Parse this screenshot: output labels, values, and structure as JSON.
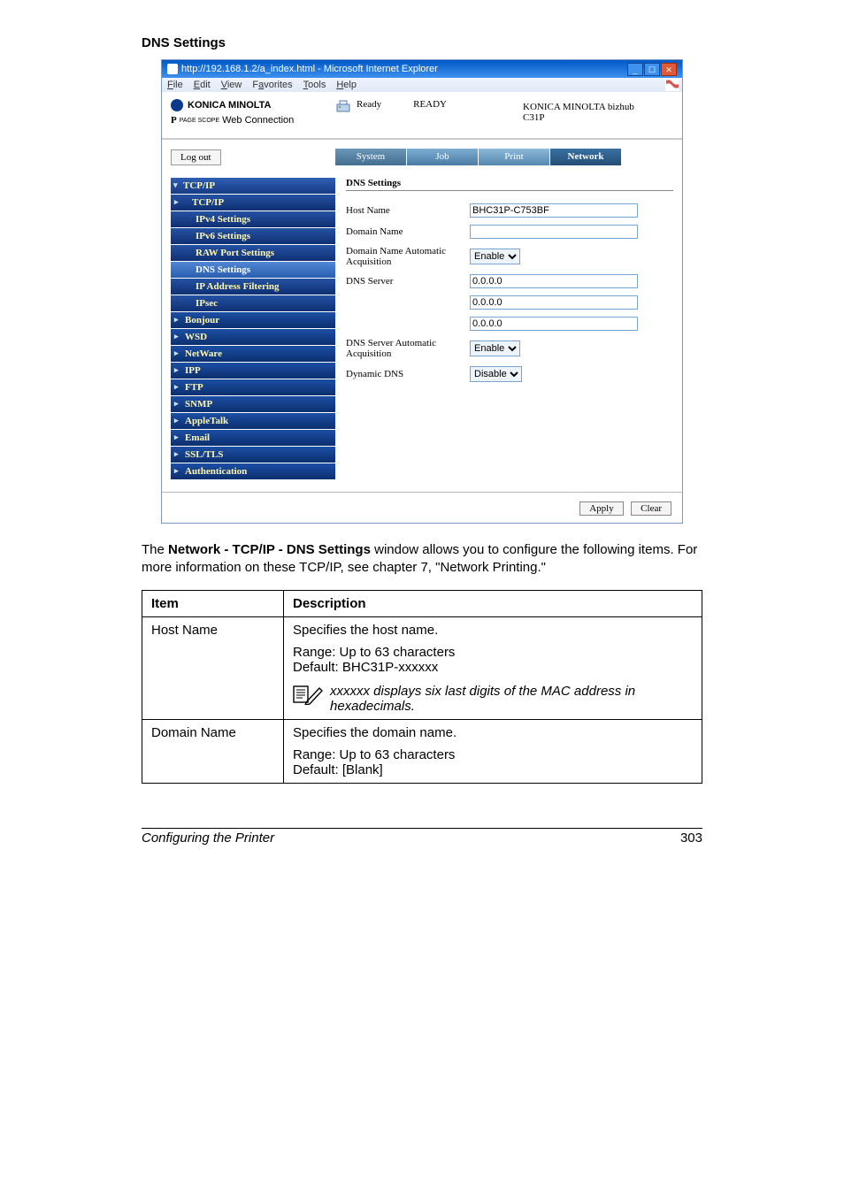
{
  "section_title": "DNS Settings",
  "browser": {
    "title": "http://192.168.1.2/a_index.html - Microsoft Internet Explorer",
    "menu": {
      "file": "File",
      "edit": "Edit",
      "view": "View",
      "favorites": "Favorites",
      "tools": "Tools",
      "help": "Help"
    }
  },
  "header": {
    "brand": "KONICA MINOLTA",
    "pagescope": "PAGE SCOPE",
    "webconn": "Web Connection",
    "ready_label": "Ready",
    "ready_status": "READY",
    "model_line1": "KONICA MINOLTA bizhub",
    "model_line2": "C31P"
  },
  "logout": "Log out",
  "tabs": {
    "system": "System",
    "job": "Job",
    "print": "Print",
    "network": "Network"
  },
  "sidebar": {
    "tcpip": "TCP/IP",
    "tcpip2": "TCP/IP",
    "ipv4": "IPv4 Settings",
    "ipv6": "IPv6 Settings",
    "raw": "RAW Port Settings",
    "dns": "DNS Settings",
    "ipfilter": "IP Address Filtering",
    "ipsec": "IPsec",
    "bonjour": "Bonjour",
    "wsd": "WSD",
    "netware": "NetWare",
    "ipp": "IPP",
    "ftp": "FTP",
    "snmp": "SNMP",
    "appletalk": "AppleTalk",
    "email": "Email",
    "ssltls": "SSL/TLS",
    "auth": "Authentication"
  },
  "panel": {
    "title": "DNS Settings",
    "host_name_label": "Host Name",
    "host_name_value": "BHC31P-C753BF",
    "domain_name_label": "Domain Name",
    "domain_name_value": "",
    "domain_auto_label": "Domain Name Automatic Acquisition",
    "domain_auto_value": "Enable",
    "dns_server_label": "DNS Server",
    "dns_server1": "0.0.0.0",
    "dns_server2": "0.0.0.0",
    "dns_server3": "0.0.0.0",
    "dns_auto_label": "DNS Server Automatic Acquisition",
    "dns_auto_value": "Enable",
    "dyndns_label": "Dynamic DNS",
    "dyndns_value": "Disable",
    "apply": "Apply",
    "clear": "Clear"
  },
  "description": {
    "pre": "The ",
    "bold": "Network - TCP/IP - DNS Settings",
    "post": " window allows you to configure the following items. For more information on these TCP/IP, see chapter 7, \"Network Printing.\""
  },
  "table": {
    "h_item": "Item",
    "h_desc": "Description",
    "r1_item": "Host Name",
    "r1_line1": "Specifies the host name.",
    "r1_range": "Range:   Up to 63 characters",
    "r1_default": "Default:  BHC31P-xxxxxx",
    "r1_note": "xxxxxx displays six last digits of the MAC address in hexadecimals.",
    "r2_item": "Domain Name",
    "r2_line1": "Specifies the domain name.",
    "r2_range": "Range:   Up to 63 characters",
    "r2_default": "Default:  [Blank]"
  },
  "footer": {
    "left": "Configuring the Printer",
    "right": "303"
  }
}
